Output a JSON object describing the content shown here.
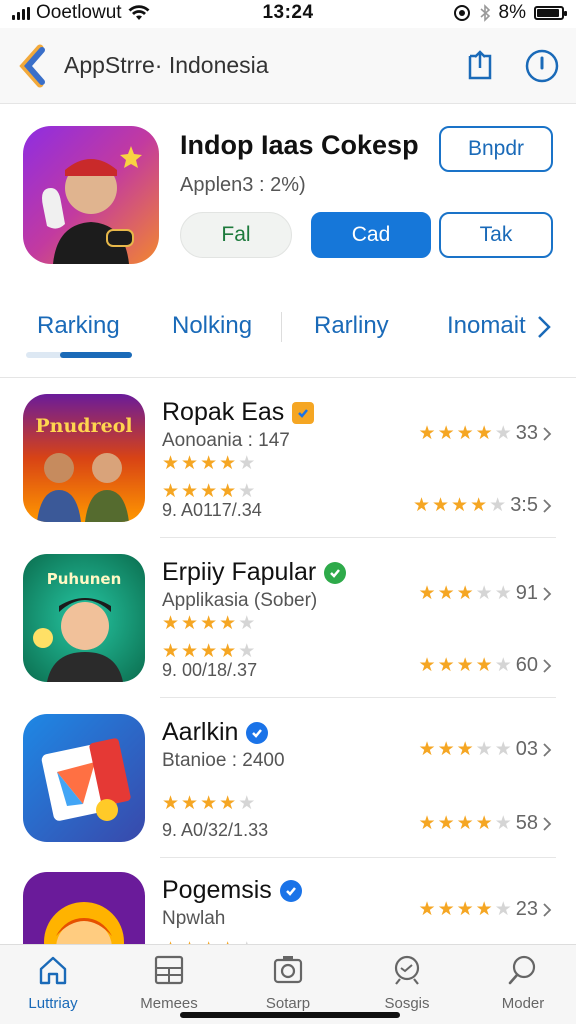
{
  "status_bar": {
    "carrier": "Ooetlowut",
    "time": "13:24",
    "battery_text": "8%",
    "battery_level": 0.9
  },
  "nav": {
    "title": "AppStrre· Indonesia",
    "back_icon": "back-chevron-icon",
    "share_icon": "share-icon",
    "info_icon": "info-icon"
  },
  "app": {
    "title": "Indop Iaas Cokesp",
    "subtitle": "Applen3 : 2%)",
    "buttons": {
      "top_right": "Bnpdr",
      "ghost": "Fal",
      "primary": "Cad",
      "outline": "Tak"
    }
  },
  "tabs": {
    "items": [
      "Rarking",
      "Nolking",
      "Rarliny",
      "Inomait"
    ],
    "active_index": 0
  },
  "list": {
    "items": [
      {
        "title": "Ropak Eas",
        "icon_text": "Pnudreol",
        "subtitle": "Aonoania : 147",
        "meta": "9. A0117/.34",
        "rating_top": "33",
        "rating_bottom": "3:5",
        "sub_stars": 4,
        "meta_stars": 3.5,
        "rt_stars": 3.5,
        "rb_stars": 4,
        "badge_color": "#f5a623"
      },
      {
        "title": "Erpiiy Fapular",
        "icon_text": "Puhunen",
        "subtitle": "Applikasia (Sober)",
        "meta": "9. 00/18/.37",
        "rating_top": "91",
        "rating_bottom": "60",
        "sub_stars": 4,
        "meta_stars": 3.5,
        "rt_stars": 3,
        "rb_stars": 3.5,
        "badge_color": "#2eaa4a"
      },
      {
        "title": "Aarlkin",
        "subtitle": "Btanioe : 2400",
        "meta": "9. A0/32/1.33",
        "rating_top": "03",
        "rating_bottom": "58",
        "sub_stars": 4,
        "meta_stars": 3.5,
        "rt_stars": 2.5,
        "rb_stars": 4,
        "badge_color": "#1a73e8"
      },
      {
        "title": "Pogemsis",
        "subtitle": "Npwlah",
        "meta": "",
        "rating_top": "23",
        "rating_bottom": "",
        "sub_stars": 4,
        "meta_stars": 0,
        "rt_stars": 4,
        "rb_stars": 0,
        "badge_color": "#1a73e8"
      }
    ]
  },
  "tab_bar": {
    "items": [
      {
        "label": "Luttriay",
        "icon": "home-icon"
      },
      {
        "label": "Memees",
        "icon": "grid-icon"
      },
      {
        "label": "Sotarp",
        "icon": "camera-icon"
      },
      {
        "label": "Sosgis",
        "icon": "search-icon"
      },
      {
        "label": "Moder",
        "icon": "magnifier-icon"
      }
    ],
    "active_index": 0
  },
  "colors": {
    "accent": "#1a6ab8",
    "primary_button": "#1677d9",
    "star": "#f5a623"
  }
}
